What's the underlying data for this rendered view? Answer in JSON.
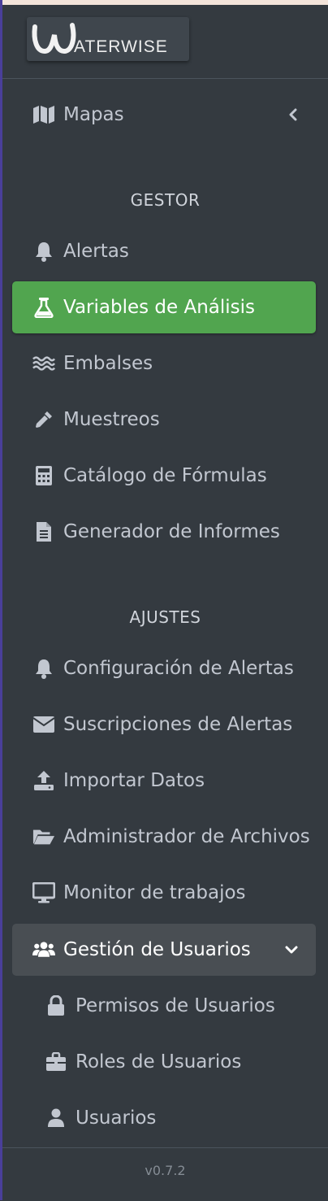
{
  "brand": {
    "logo_text": "ATERWISE"
  },
  "nav": {
    "mapas": {
      "label": "Mapas",
      "icon": "map-icon"
    },
    "gestor_header": "GESTOR",
    "alertas": {
      "label": "Alertas",
      "icon": "bell-icon"
    },
    "variables": {
      "label": "Variables de Análisis",
      "icon": "flask-icon",
      "active": true
    },
    "embalses": {
      "label": "Embalses",
      "icon": "water-icon"
    },
    "muestreos": {
      "label": "Muestreos",
      "icon": "eyedropper-icon"
    },
    "formulas": {
      "label": "Catálogo de Fórmulas",
      "icon": "calculator-icon"
    },
    "informes": {
      "label": "Generador de Informes",
      "icon": "file-report-icon"
    },
    "ajustes_header": "AJUSTES",
    "config_alertas": {
      "label": "Configuración de Alertas",
      "icon": "bell-icon"
    },
    "suscripciones": {
      "label": "Suscripciones de Alertas",
      "icon": "envelope-icon"
    },
    "importar": {
      "label": "Importar Datos",
      "icon": "upload-icon"
    },
    "archivos": {
      "label": "Administrador de Archivos",
      "icon": "folder-open-icon"
    },
    "monitor": {
      "label": "Monitor de trabajos",
      "icon": "desktop-icon"
    },
    "usuarios_group": {
      "label": "Gestión de Usuarios",
      "icon": "users-icon",
      "expanded": true
    },
    "permisos": {
      "label": "Permisos de Usuarios",
      "icon": "lock-icon"
    },
    "roles": {
      "label": "Roles de Usuarios",
      "icon": "briefcase-icon"
    },
    "usuarios": {
      "label": "Usuarios",
      "icon": "user-icon"
    }
  },
  "footer": {
    "version": "v0.7.2"
  },
  "colors": {
    "sidebar_bg": "#343a40",
    "active_bg": "#51a54f",
    "open_bg": "#494e53",
    "text": "#c2c7d0"
  }
}
